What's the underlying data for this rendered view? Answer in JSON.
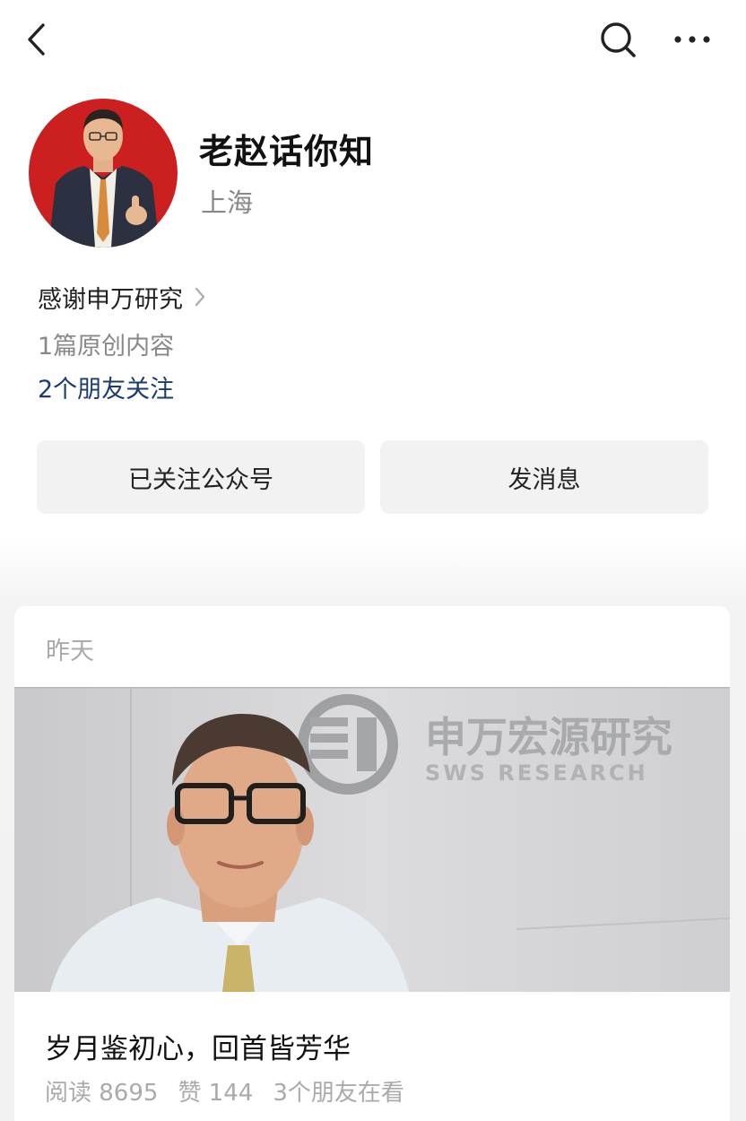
{
  "topbar": {
    "back_icon": "chevron-left-icon",
    "search_icon": "search-icon",
    "more_icon": "more-horizontal-icon"
  },
  "profile": {
    "name": "老赵话你知",
    "location": "上海",
    "intro": "感谢申万研究",
    "original_count": "1篇原创内容",
    "friends_follow": "2个朋友关注"
  },
  "actions": {
    "followed_label": "已关注公众号",
    "message_label": "发消息"
  },
  "feed": {
    "date": "昨天",
    "article": {
      "title": "岁月鉴初心，回首皆芳华",
      "image_sign_cn": "申万宏源研究",
      "image_sign_en": "SWS RESEARCH",
      "reads": "阅读 8695",
      "likes": "赞 144",
      "friends_viewing": "3个朋友在看"
    }
  },
  "colors": {
    "link": "#1a3c6e",
    "avatar_bg": "#cc1f1f",
    "button_bg": "#f2f2f2"
  }
}
